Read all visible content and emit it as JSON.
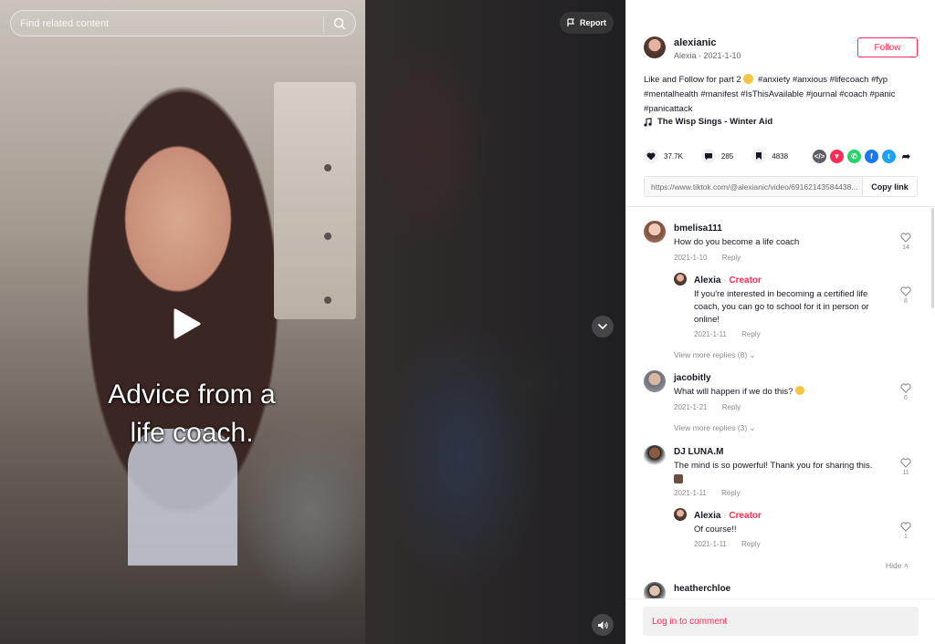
{
  "search": {
    "placeholder": "Find related content"
  },
  "report": {
    "label": "Report"
  },
  "video": {
    "caption_line1": "Advice from a",
    "caption_line2": "life coach."
  },
  "author": {
    "username": "alexianic",
    "display_name": "Alexia",
    "date": "2021-1-10",
    "follow_label": "Follow"
  },
  "description": {
    "text": "Like and Follow for part 2",
    "hashtags": [
      "#anxiety",
      "#anxious",
      "#lifecoach",
      "#fyp",
      "#mentalhealth",
      "#manifest",
      "#IsThisAvailable",
      "#journal",
      "#coach",
      "#panic",
      "#panicattack"
    ]
  },
  "music": {
    "title": "The Wisp Sings - Winter Aid"
  },
  "stats": {
    "likes": "37.7K",
    "comments": "285",
    "saves": "4838"
  },
  "share_icons": [
    "embed-icon",
    "send-icon",
    "whatsapp-icon",
    "facebook-icon",
    "twitter-icon",
    "share-arrow-icon"
  ],
  "link": {
    "url": "https://www.tiktok.com/@alexianic/video/69162143584438...",
    "copy_label": "Copy link"
  },
  "comments": [
    {
      "user": "bmelisa111",
      "text": "How do you become a life coach",
      "date": "2021-1-10",
      "reply": "Reply",
      "likes": "14"
    },
    {
      "user": "Alexia",
      "badge": "Creator",
      "text": "If you're interested in becoming a certified life coach, you can go to school for it in person or online!",
      "date": "2021-1-11",
      "reply": "Reply",
      "likes": "8"
    },
    {
      "user": "jacobitly",
      "text": "What will happen if we do this?",
      "date": "2021-1-21",
      "reply": "Reply",
      "likes": "6"
    },
    {
      "user": "DJ LUNA.M",
      "text": "The mind is so powerful! Thank you for sharing this.",
      "date": "2021-1-11",
      "reply": "Reply",
      "likes": "11"
    },
    {
      "user": "Alexia",
      "badge": "Creator",
      "text": "Of course!!",
      "date": "2021-1-11",
      "reply": "Reply",
      "likes": "1"
    },
    {
      "user": "heatherchloe"
    }
  ],
  "view_more_1": "View more replies (8)",
  "view_more_2": "View more replies (3)",
  "hide_label": "Hide",
  "login": {
    "label": "Log in to comment"
  },
  "colors": {
    "accent": "#fe2c55",
    "text": "#161823",
    "muted": "#8a8b91"
  }
}
